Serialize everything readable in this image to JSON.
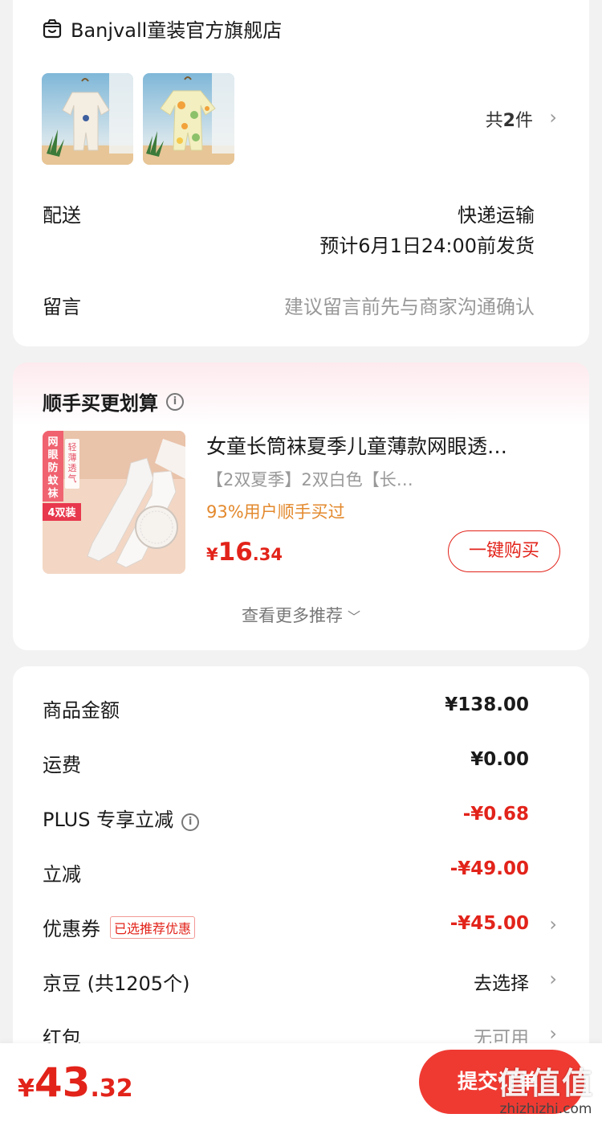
{
  "store": {
    "name": "Banjvall童装官方旗舰店",
    "item_count_prefix": "共",
    "item_count": "2",
    "item_count_suffix": "件"
  },
  "delivery": {
    "label": "配送",
    "method": "快递运输",
    "eta": "预计6月1日24:00前发货"
  },
  "message": {
    "label": "留言",
    "placeholder": "建议留言前先与商家沟通确认"
  },
  "recommend": {
    "title": "顺手买更划算",
    "product_name": "女童长筒袜夏季儿童薄款网眼透…",
    "spec": "【2双夏季】2双白色【长…",
    "bought": "93%用户顺手买过",
    "price_symbol": "¥",
    "price_int": "16",
    "price_dec": ".34",
    "buy_label": "一键购买",
    "more_label": "查看更多推荐",
    "image_text": {
      "vertical": "网眼防蚊袜",
      "badge": "轻薄透气",
      "pairs": "4双装"
    }
  },
  "summary": {
    "rows": [
      {
        "label": "商品金额",
        "amount": "¥138.00"
      },
      {
        "label": "运费",
        "amount": "¥0.00"
      },
      {
        "label": "PLUS 专享立减",
        "amount": "-¥0.68"
      },
      {
        "label": "立减",
        "amount": "-¥49.00"
      },
      {
        "label": "优惠券",
        "tag": "已选推荐优惠",
        "amount": "-¥45.00"
      },
      {
        "label": "京豆 (共1205个)",
        "amount": "去选择"
      },
      {
        "label": "红包",
        "amount": "无可用"
      }
    ]
  },
  "footer": {
    "price_symbol": "¥",
    "price_int": "43",
    "price_dec": ".32",
    "submit_label": "提交订单",
    "watermark_logo": "值值值",
    "watermark_url": "zhizhizhi.com"
  },
  "colors": {
    "accent_red": "#e2231a",
    "bought_orange": "#e3892d",
    "submit_bg": "#ef3a32"
  }
}
